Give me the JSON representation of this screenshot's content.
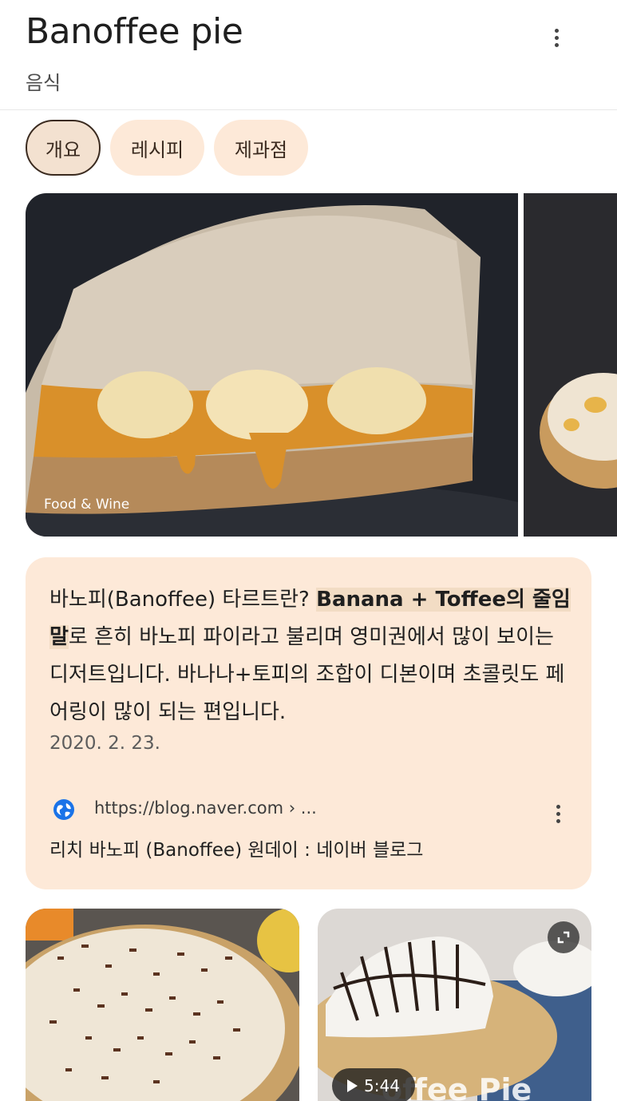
{
  "header": {
    "title": "Banoffee pie",
    "subtitle": "음식"
  },
  "chips": [
    {
      "label": "개요",
      "active": true
    },
    {
      "label": "레시피",
      "active": false
    },
    {
      "label": "제과점",
      "active": false
    }
  ],
  "hero": {
    "caption": "Food & Wine"
  },
  "snippet": {
    "text_before": "바노피(Banoffee) 타르트란? ",
    "highlight": "Banana + Toffee의 줄임말",
    "text_after": "로 흔히 바노피 파이라고 불리며 영미권에서 많이 보이는 디저트입니다. 바나나+토피의 조합이 디본이며 초콜릿도 페어링이 많이 되는 편입니다.",
    "date": "2020. 2. 23.",
    "source_url": "https://blog.naver.com › ...",
    "source_title": "리치 바노피 (Banoffee) 원데이 : 네이버 블로그"
  },
  "video": {
    "duration": "5:44",
    "overlay_text": "offee Pie"
  },
  "icons": {
    "more": "more-vert-icon",
    "globe": "globe-icon",
    "expand": "expand-icon",
    "play": "play-icon"
  },
  "colors": {
    "chip_bg": "#fde9d8",
    "card_bg": "#fde9d8",
    "highlight_bg": "#f2dcc4",
    "source_icon": "#1a73e8"
  }
}
